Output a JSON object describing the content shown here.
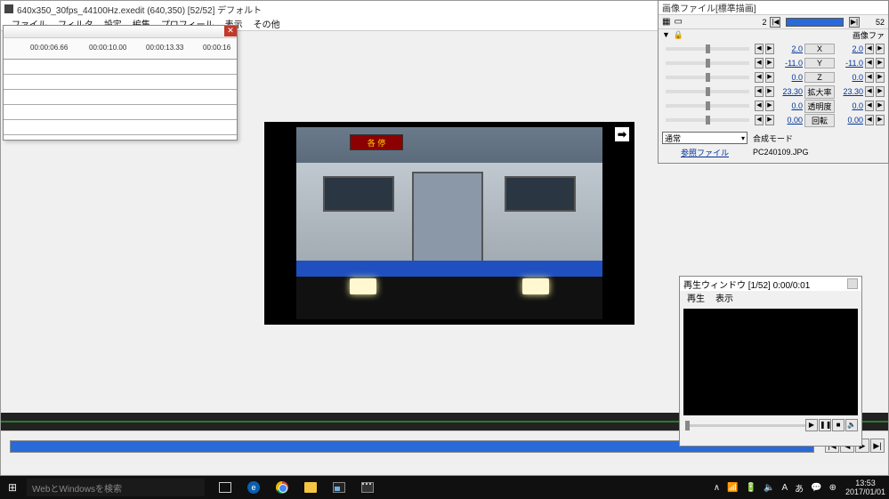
{
  "main": {
    "title": "640x350_30fps_44100Hz.exedit (640,350)  [52/52]  デフォルト",
    "menu": [
      "ファイル",
      "フィルタ",
      "設定",
      "編集",
      "プロフィール",
      "表示",
      "その他"
    ]
  },
  "timeline": {
    "times": [
      "00:00:06.66",
      "00:00:10.00",
      "00:00:13.33",
      "00:00:16"
    ]
  },
  "preview": {
    "sign": "各 停",
    "arrow": "➡"
  },
  "seek": {
    "buttons": [
      "|◀",
      "◀",
      "▶",
      "▶|"
    ]
  },
  "prop": {
    "title": "画像ファイル[標準描画]",
    "frame_left": "2",
    "frame_right": "52",
    "subsuffix": "画像ファ",
    "rows": [
      {
        "v1": "2.0",
        "label": "X",
        "v2": "2.0"
      },
      {
        "v1": "-11.0",
        "label": "Y",
        "v2": "-11.0"
      },
      {
        "v1": "0.0",
        "label": "Z",
        "v2": "0.0"
      },
      {
        "v1": "23.30",
        "label": "拡大率",
        "v2": "23.30"
      },
      {
        "v1": "0.0",
        "label": "透明度",
        "v2": "0.0"
      },
      {
        "v1": "0.00",
        "label": "回転",
        "v2": "0.00"
      }
    ],
    "combo": "通常",
    "mode_label": "合成モード",
    "ref_label": "参照ファイル",
    "ref_file": "PC240109.JPG"
  },
  "play": {
    "title": "再生ウィンドウ  [1/52]  0:00/0:01",
    "menu": [
      "再生",
      "表示"
    ],
    "buttons": [
      "▶",
      "❚❚",
      "■",
      "🔈"
    ]
  },
  "taskbar": {
    "search_placeholder": "WebとWindowsを検索",
    "time": "13:53",
    "date": "2017/01/01",
    "tray": [
      "∧",
      "📶",
      "🔋",
      "🔈",
      "A",
      "あ",
      "💬",
      "⊕"
    ]
  }
}
